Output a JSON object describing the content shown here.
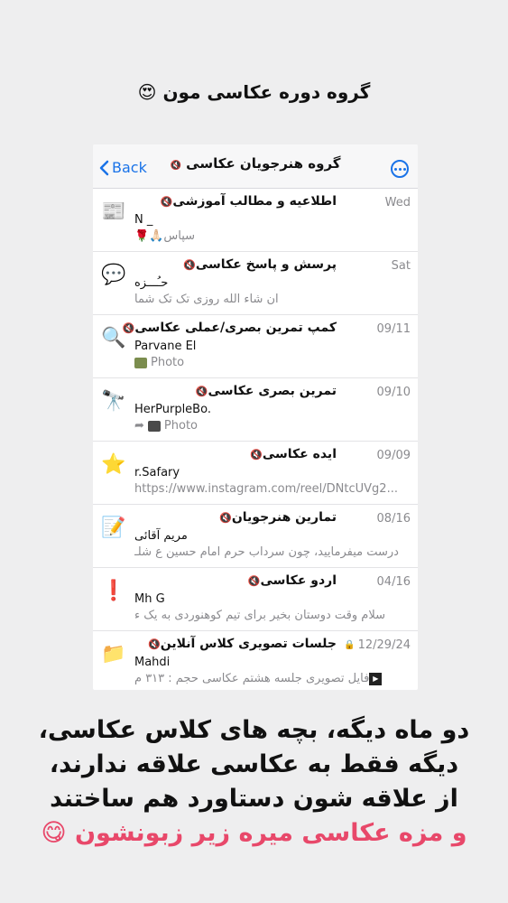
{
  "top_caption": "گروه دوره عکاسی مون",
  "top_caption_emoji": "😍",
  "navbar": {
    "back_label": "Back",
    "title": "گروه هنرجویان عکاسی",
    "title_mute": "🔇"
  },
  "rows": [
    {
      "icon": "📰",
      "title": "اطلاعیه و مطالب آموزشی",
      "date": "Wed",
      "sender": "N _",
      "preview": "سپاس🙏🏻🌹"
    },
    {
      "icon": "💬",
      "title": "پرسش و پاسخ عکاسی",
      "date": "Sat",
      "sender": "حـُـــزه",
      "preview": "ان شاء الله روزی تک تک شما"
    },
    {
      "icon": "🔍",
      "title": "کمپ تمرین بصری/عملی عکاسی",
      "date": "09/11",
      "sender": "Parvane El",
      "preview": "Photo"
    },
    {
      "icon": "🔭",
      "title": "تمرین بصری عکاسی",
      "date": "09/10",
      "sender": "HerPurpleBo.",
      "preview": "Photo"
    },
    {
      "icon": "⭐",
      "title": "ایده عکاسی",
      "date": "09/09",
      "sender": "r.Safary",
      "preview": "https://www.instagram.com/reel/DNtcUVg2..."
    },
    {
      "icon": "📝",
      "title": "تمارین هنرجویان",
      "date": "08/16",
      "sender": "مریم آقائی",
      "preview": "درست میفرمایید، چون سرداب حرم امام حسین ع شلـ"
    },
    {
      "icon": "❗",
      "title": "اردو عکاسی",
      "date": "04/16",
      "sender": "Mh G",
      "preview": "سلام وقت دوستان بخیر برای تیم کوهنوردی به یک ء"
    },
    {
      "icon": "📁",
      "title": "جلسات تصویری کلاس آنلاین",
      "date": "12/29/24",
      "sender": "Mahdi",
      "preview": "فایل تصویری جلسه هشتم عکاسی حجم : ۳۱۳ م"
    }
  ],
  "mute_glyph": "🔇",
  "lock_glyph": "🔒",
  "forward_glyph": "➦",
  "bottom_caption": {
    "line1": "دو ماه دیگه، بچه های کلاس عکاسی،",
    "line2": "دیگه فقط به عکاسی علاقه ندارند،",
    "line3": "از علاقه شون دستاورد هم ساختند",
    "line4": "و مزه عکاسی میره زیر زبونشون",
    "line4_emoji": "😋"
  }
}
